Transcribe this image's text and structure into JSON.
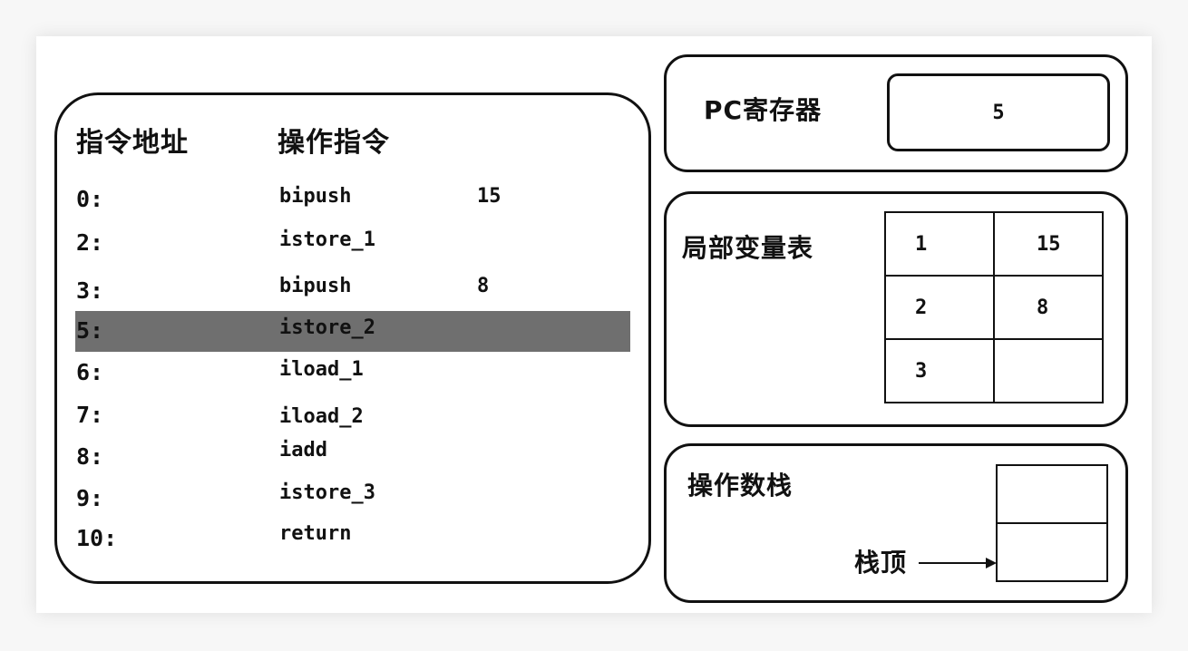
{
  "program": {
    "header_address": "指令地址",
    "header_instruction": "操作指令",
    "rows": [
      {
        "addr": "0:",
        "op": "bipush",
        "arg": "15"
      },
      {
        "addr": "2:",
        "op": "istore_1",
        "arg": ""
      },
      {
        "addr": "3:",
        "op": "bipush",
        "arg": "8"
      },
      {
        "addr": "5:",
        "op": "istore_2",
        "arg": ""
      },
      {
        "addr": "6:",
        "op": "iload_1",
        "arg": ""
      },
      {
        "addr": "7:",
        "op": "iload_2",
        "arg": ""
      },
      {
        "addr": "8:",
        "op": "iadd",
        "arg": ""
      },
      {
        "addr": "9:",
        "op": "istore_3",
        "arg": ""
      },
      {
        "addr": "10:",
        "op": "return",
        "arg": ""
      }
    ],
    "highlighted_address": "5:"
  },
  "pc_register": {
    "label": "PC寄存器",
    "value": "5"
  },
  "local_variables": {
    "label": "局部变量表",
    "slots": [
      {
        "index": "1",
        "value": "15"
      },
      {
        "index": "2",
        "value": "8"
      },
      {
        "index": "3",
        "value": ""
      }
    ]
  },
  "operand_stack": {
    "label": "操作数栈",
    "top_label": "栈顶",
    "slots": [
      "",
      ""
    ]
  },
  "colors": {
    "highlight": "#6f6f6f",
    "border": "#111111",
    "background": "#ffffff"
  }
}
